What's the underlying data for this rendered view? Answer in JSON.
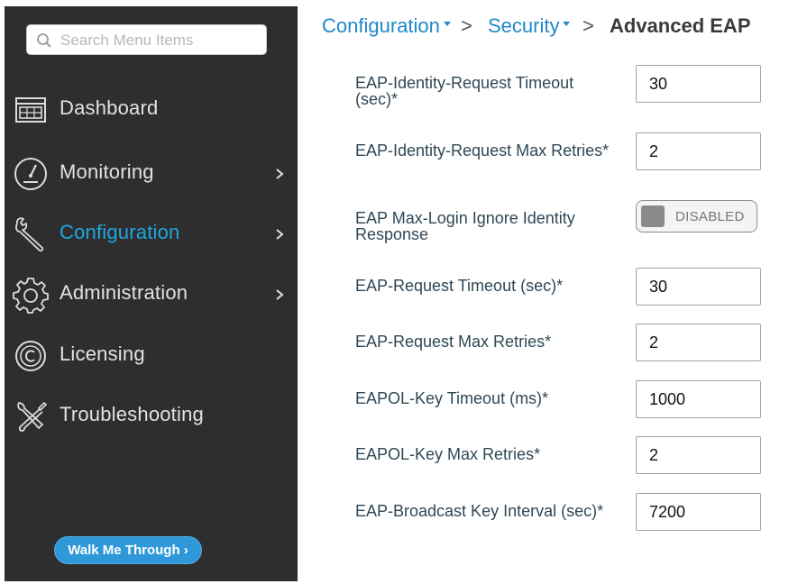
{
  "sidebar": {
    "search": {
      "placeholder": "Search Menu Items"
    },
    "items": [
      {
        "label": "Dashboard",
        "icon": "dashboard-icon"
      },
      {
        "label": "Monitoring",
        "icon": "gauge-icon"
      },
      {
        "label": "Configuration",
        "icon": "wrench-icon",
        "active": true
      },
      {
        "label": "Administration",
        "icon": "gear-icon"
      },
      {
        "label": "Licensing",
        "icon": "licensing-icon"
      },
      {
        "label": "Troubleshooting",
        "icon": "tools-icon"
      }
    ],
    "walk_me_through": "Walk Me Through ›"
  },
  "breadcrumb": {
    "items": [
      "Configuration",
      "Security"
    ],
    "separator": ">",
    "current": "Advanced EAP"
  },
  "form": {
    "fields": [
      {
        "label": "EAP-Identity-Request Timeout (sec)*",
        "value": "30"
      },
      {
        "label": "EAP-Identity-Request Max Retries*",
        "value": "2"
      },
      {
        "label": "EAP Max-Login Ignore Identity Response",
        "toggle_state": "DISABLED"
      },
      {
        "label": "EAP-Request Timeout (sec)*",
        "value": "30"
      },
      {
        "label": "EAP-Request Max Retries*",
        "value": "2"
      },
      {
        "label": "EAPOL-Key Timeout (ms)*",
        "value": "1000"
      },
      {
        "label": "EAPOL-Key Max Retries*",
        "value": "2"
      },
      {
        "label": "EAP-Broadcast Key Interval (sec)*",
        "value": "7200"
      }
    ]
  },
  "colors": {
    "sidebar_bg": "#2e2e2e",
    "accent": "#1ea7e1",
    "link": "#1f89c8",
    "button": "#2e98d8"
  }
}
